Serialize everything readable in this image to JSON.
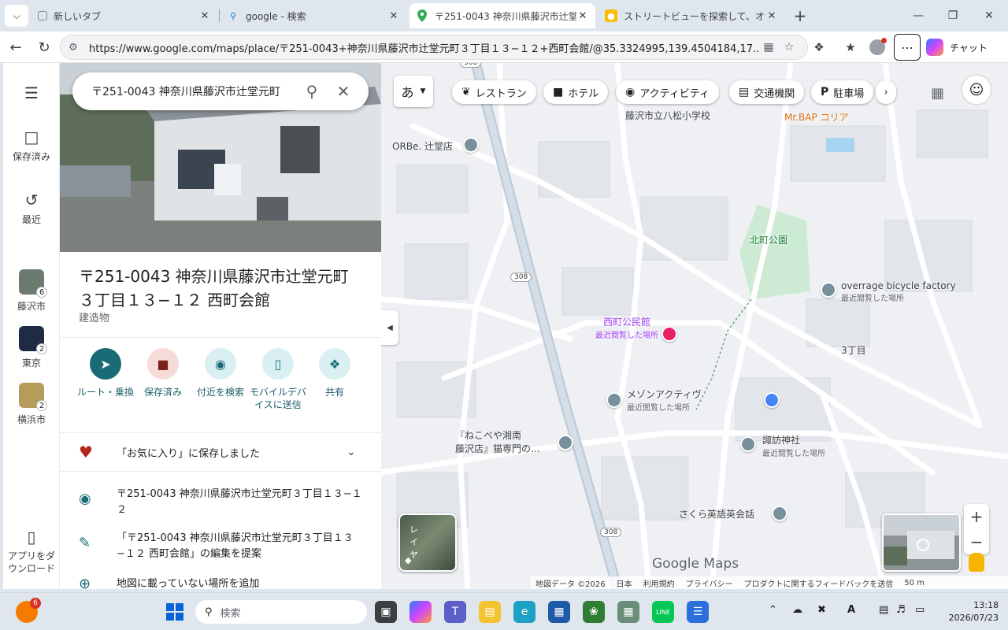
{
  "browser": {
    "tabs": [
      {
        "label": "新しいタブ",
        "icon": "new-tab-page-icon",
        "active": false
      },
      {
        "label": "google - 検索",
        "icon": "search-icon",
        "active": false
      },
      {
        "label": "〒251-0043 神奈川県藤沢市辻堂元",
        "icon": "maps-pin-icon",
        "active": true
      },
      {
        "label": "ストリートビューを探索して、オリジナルの",
        "icon": "street-view-icon",
        "active": false
      }
    ],
    "url": "https://www.google.com/maps/place/〒251-0043+神奈川県藤沢市辻堂元町３丁目１３−１２+西町会館/@35.3324995,139.4504184,17...",
    "chat_label": "チャット"
  },
  "rail": {
    "saved_label": "保存済み",
    "recent_label": "最近",
    "places": [
      {
        "label": "藤沢市",
        "badge": "6",
        "color": "#6d7a6e"
      },
      {
        "label": "東京",
        "badge": "2",
        "color": "#1f2a44"
      },
      {
        "label": "横浜市",
        "badge": "2",
        "color": "#b59c5a"
      }
    ],
    "download_label": "アプリをダウンロード"
  },
  "panel": {
    "search_query": "〒251-0043 神奈川県藤沢市辻堂元町",
    "title": "〒251-0043 神奈川県藤沢市辻堂元町３丁目１３−１２ 西町会館",
    "category": "建造物",
    "actions": [
      {
        "label": "ルート・乗換",
        "icon": "directions-icon"
      },
      {
        "label": "保存済み",
        "icon": "bookmark-icon"
      },
      {
        "label": "付近を検索",
        "icon": "nearby-icon"
      },
      {
        "label": "モバイルデバイスに送信",
        "icon": "send-to-phone-icon"
      },
      {
        "label": "共有",
        "icon": "share-icon"
      }
    ],
    "saved_text": "「お気に入り」に保存しました",
    "address": "〒251-0043 神奈川県藤沢市辻堂元町３丁目１３−１２",
    "suggest_edit": "「〒251-0043 神奈川県藤沢市辻堂元町３丁目１３−１２ 西町会館」の編集を提案",
    "add_place": "地図に載っていない場所を追加"
  },
  "map": {
    "ime_label": "あ",
    "chips": [
      {
        "label": "レストラン",
        "icon": "restaurant-icon"
      },
      {
        "label": "ホテル",
        "icon": "hotel-icon"
      },
      {
        "label": "アクティビティ",
        "icon": "camera-icon"
      },
      {
        "label": "交通機関",
        "icon": "transit-icon"
      },
      {
        "label": "駐車場",
        "icon": "parking-icon"
      }
    ],
    "labels": {
      "school": "藤沢市立八松小学校",
      "orbe": "ORBe. 辻堂店",
      "park": "北町公園",
      "bicycle": "overrage bicycle factory",
      "bicycle_sub": "最近閲覧した場所",
      "hall": "西町公民館",
      "hall_sub": "最近閲覧した場所",
      "chome": "3丁目",
      "maison": "メゾンアクティヴ",
      "maison_sub": "最近閲覧した場所",
      "neko": "『ねこべや湘南",
      "neko2": "藤沢店』猫専門の...",
      "shrine": "諏訪神社",
      "shrine_sub": "最近閲覧した場所",
      "english": "さくら英語英会話",
      "mrbap": "Mr.BAP コリア",
      "route1": "308",
      "route2": "308",
      "route3": "308"
    },
    "layer_label": "レイヤ",
    "logo": "Google Maps",
    "footer": [
      "地図データ ©2026",
      "日本",
      "利用規約",
      "プライバシー",
      "プロダクトに関するフィードバックを送信",
      "50 m"
    ]
  },
  "taskbar": {
    "search_placeholder": "検索",
    "notification_badge": "6",
    "time": "13:18",
    "date": "2026/07/23"
  }
}
